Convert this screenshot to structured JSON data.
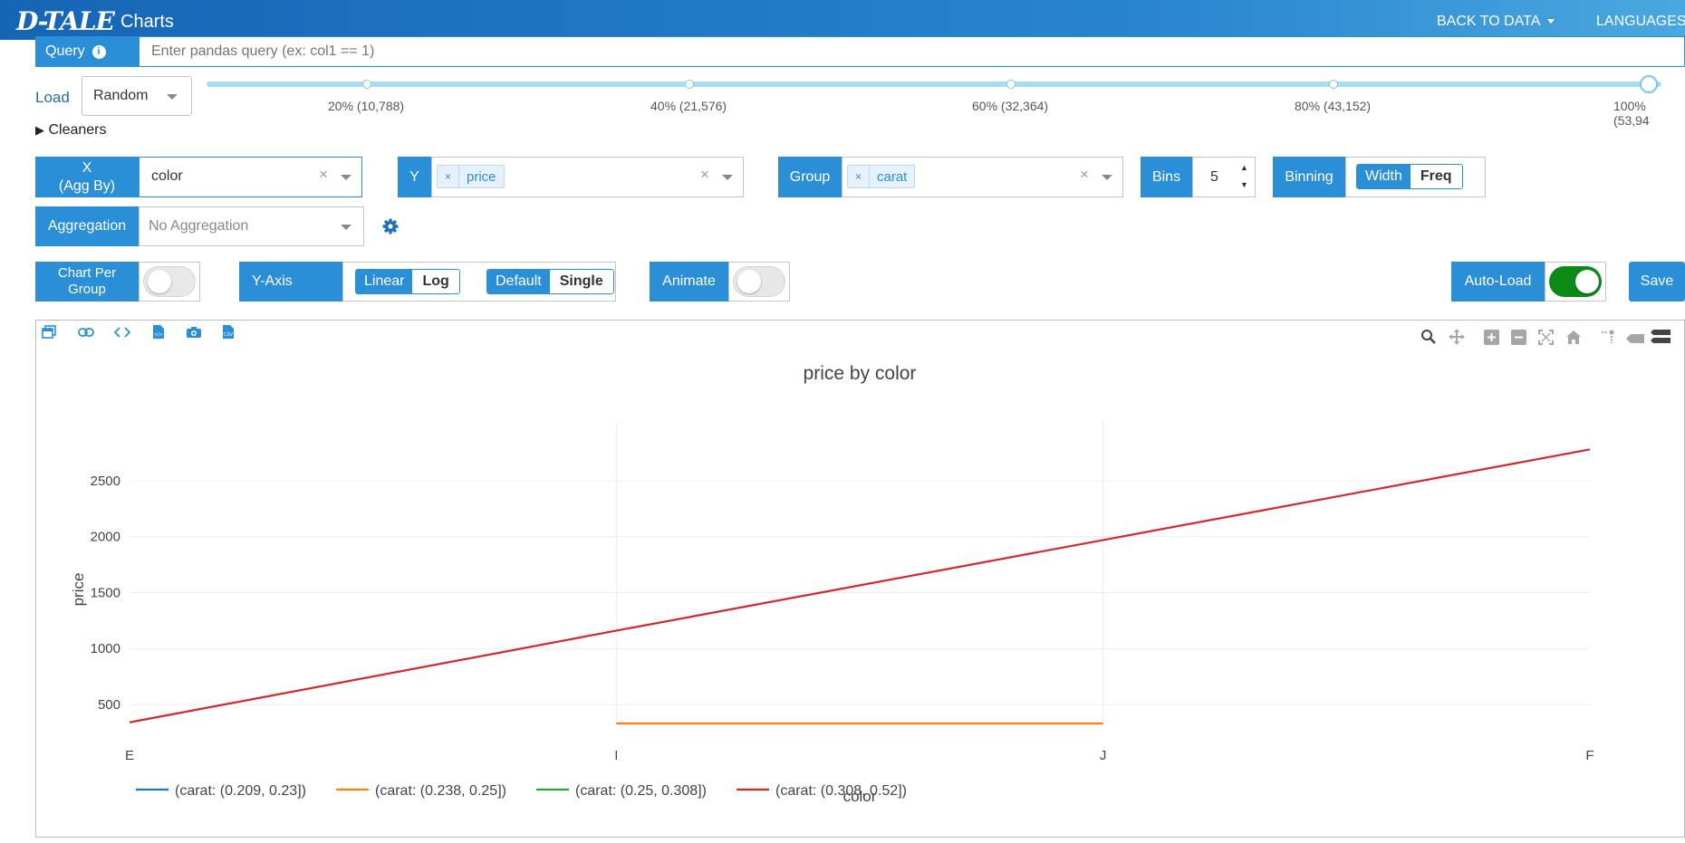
{
  "header": {
    "logo": "D-TALE",
    "title": "Charts",
    "back_to_data": "BACK TO DATA",
    "languages": "LANGUAGES"
  },
  "query": {
    "label": "Query",
    "info_icon": "info-icon",
    "placeholder": "Enter pandas query (ex: col1 == 1)"
  },
  "load": {
    "label": "Load",
    "mode": "Random",
    "slider_value": 1.0,
    "slider_ticks": [
      "20% (10,788)",
      "40% (21,576)",
      "60% (32,364)",
      "80% (43,152)",
      "100% (53,94"
    ]
  },
  "cleaners": {
    "label": "Cleaners"
  },
  "x": {
    "label_line1": "X",
    "label_line2": "(Agg By)",
    "value": "color",
    "clear": "×"
  },
  "y": {
    "label": "Y",
    "tag_x": "×",
    "tag": "price",
    "clear": "×"
  },
  "group": {
    "label": "Group",
    "tag_x": "×",
    "tag": "carat",
    "clear": "×"
  },
  "bins": {
    "label": "Bins",
    "value": "5"
  },
  "binning": {
    "label": "Binning",
    "options": [
      "Width",
      "Freq"
    ],
    "selected": "Width"
  },
  "aggregation": {
    "label": "Aggregation",
    "placeholder": "No Aggregation",
    "gear_icon": "gear-icon"
  },
  "chart_per_group": {
    "label_line1": "Chart Per",
    "label_line2": "Group",
    "on": false
  },
  "yaxis": {
    "label": "Y-Axis",
    "scale_options": [
      "Linear",
      "Log"
    ],
    "scale_selected": "Linear",
    "mode_options": [
      "Default",
      "Single"
    ],
    "mode_selected": "Default"
  },
  "animate": {
    "label": "Animate",
    "on": false
  },
  "autoload": {
    "label": "Auto-Load",
    "on": true,
    "on_color": "#0c8a16"
  },
  "save": {
    "label": "Save"
  },
  "chart_toolbar_left": [
    "popup-icon",
    "link-icon",
    "code-icon",
    "html-export-icon",
    "camera-icon",
    "csv-export-icon"
  ],
  "modebar": [
    "zoom-icon",
    "pan-icon",
    "zoom-in-icon",
    "zoom-out-icon",
    "autoscale-icon",
    "reset-axes-icon",
    "spike-lines-icon",
    "hover-closest-icon",
    "hover-compare-icon"
  ],
  "chart_data": {
    "type": "line",
    "title": "price by color",
    "xlabel": "color",
    "ylabel": "price",
    "categories": [
      "E",
      "I",
      "J",
      "F"
    ],
    "yticks": [
      500,
      1000,
      1500,
      2000,
      2500
    ],
    "ylim": [
      330,
      2880
    ],
    "grid": true,
    "legend": "bottom",
    "series": [
      {
        "name": "(carat: (0.209, 0.23])",
        "color": "#1f77b4",
        "values": [
          null,
          null,
          null,
          null
        ]
      },
      {
        "name": "(carat: (0.238, 0.25])",
        "color": "#ff7f0e",
        "values": [
          null,
          330,
          330,
          null
        ]
      },
      {
        "name": "(carat: (0.25, 0.308])",
        "color": "#2ca02c",
        "values": [
          null,
          null,
          null,
          null
        ]
      },
      {
        "name": "(carat: (0.308, 0.52])",
        "color": "#d62728",
        "values": [
          340,
          1160,
          1970,
          2780
        ]
      }
    ]
  }
}
